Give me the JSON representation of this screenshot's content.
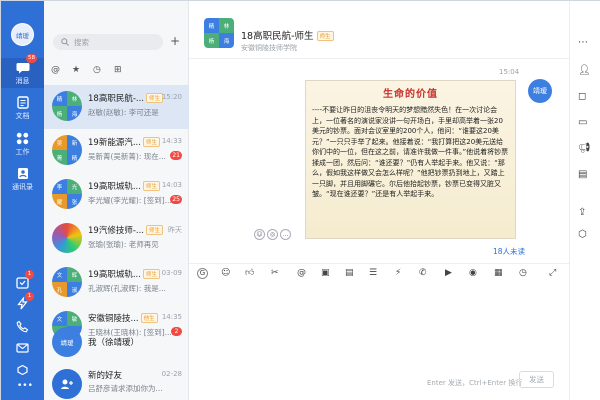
{
  "window_controls": {
    "minimize": "—",
    "maximize": "☐",
    "close": "✕"
  },
  "nav": {
    "avatar_text": "靖瑷",
    "items": [
      {
        "label": "消息",
        "badge": "58"
      },
      {
        "label": "文档"
      },
      {
        "label": "工作"
      },
      {
        "label": "通讯录"
      }
    ],
    "bottom_badges": [
      "1",
      "1"
    ]
  },
  "list": {
    "search_placeholder": "搜索",
    "filters": [
      "@",
      "★",
      "◷",
      "⊞"
    ],
    "conversations": [
      {
        "title": "18高职民航-...",
        "tag": "师生",
        "time": "15:20",
        "sub": "赵敏(赵敏): 李可还是",
        "badge": "",
        "avatar_cells": [
          "精",
          "林",
          "杨",
          "海"
        ]
      },
      {
        "title": "19新能源汽...",
        "tag": "师生",
        "time": "14:33",
        "sub": "吴新菁(吴新菁): 现在...",
        "badge": "21",
        "avatar_cells": [
          "吴",
          "新",
          "菁",
          "精"
        ]
      },
      {
        "title": "19高职城轨...",
        "tag": "师生",
        "time": "14:03",
        "sub": "李光耀(李光耀): [签到]...",
        "badge": "25",
        "avatar_cells": [
          "李",
          "光",
          "耀",
          "张"
        ]
      },
      {
        "title": "19汽修技师-...",
        "tag": "师生",
        "time": "昨天",
        "sub": "张瑜(张瑜): 老师再见",
        "badge": "",
        "avatar_cells": []
      },
      {
        "title": "19高职城轨...",
        "tag": "师生",
        "time": "03-09",
        "sub": "孔淑辉(孔淑辉): 我是...",
        "badge": "",
        "avatar_cells": [
          "文",
          "辉",
          "孔",
          "淑"
        ]
      },
      {
        "title": "安徽铜陵技...",
        "tag": "他生",
        "time": "14:35",
        "sub": "王晓林(王晓林): [签到]...",
        "badge": "2",
        "avatar_cells": [
          "文",
          "敏",
          "林",
          "晓"
        ]
      },
      {
        "title": "我（徐靖瑷）",
        "tag": "",
        "time": "",
        "sub": "",
        "badge": "",
        "avatar_text": "靖瑷"
      },
      {
        "title": "新的好友",
        "tag": "",
        "time": "02-28",
        "sub": "吕舒彦请求添加你为...",
        "badge": ""
      }
    ]
  },
  "chat": {
    "avatar_cells": [
      "精",
      "林",
      "杨",
      "海"
    ],
    "title": "18高职民航-师生",
    "tag": "师生",
    "org": "安徽铜陵技师学院",
    "time": "15:04",
    "me": "靖瑷",
    "image_title": "生命的价值",
    "image_text": "----不要让昨日的沮丧令明天的梦想黯然失色！在一次讨论会上，一位著名的演说家没讲一句开场白，手里却高举着一张20美元的钞票。面对会议室里的200个人，他问：“谁要这20美元？”一只只手举了起来。他接着说：“我打算把这20美元送给你们中的一位，但在这之前，请准许我做一件事。”他说着将钞票揉成一团，然后问：“谁还要？”仍有人举起手来。他又说：“那么，假如我这样做又会怎么样呢？”他把钞票扔到地上，又踏上一只脚，并且用脚碾它。尔后他拾起钞票，钞票已变得又脏又皱。“现在谁还要？”还是有人举起手来。",
    "read_count": "18人未读",
    "send_hint": "Enter 发送，Ctrl+Enter 换行",
    "send_label": "发送"
  },
  "colors": {
    "nav": "#2f70d7",
    "accent": "#2f70d7",
    "badge": "#f24a43",
    "tag": "#e79a2b"
  }
}
